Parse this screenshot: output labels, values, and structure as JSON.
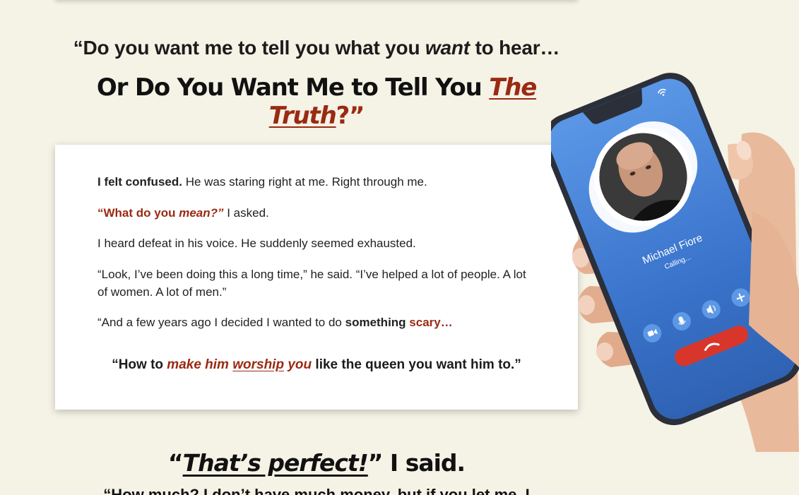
{
  "headline": {
    "line1_pre": "“Do you want me to tell you what you ",
    "line1_em": "want",
    "line1_post": " to hear…",
    "line2_pre": "Or Do You Want Me to Tell You ",
    "line2_truth": "The Truth",
    "line2_post": "?”"
  },
  "story": {
    "p1_bold": "I felt confused.",
    "p1_rest": " He was staring right at me. Right through me.",
    "p2_quote_a": "“What do you ",
    "p2_quote_b": "mean?”",
    "p2_rest": " I asked.",
    "p3": "I heard defeat in his voice. He suddenly seemed exhausted.",
    "p4": "“Look, I’ve been doing this a long time,” he said. “I’ve helped a lot of people. A lot of women. A lot of men.”",
    "p5_pre": "“And a few years ago I decided I wanted to do ",
    "p5_bold": "something",
    "p5_accent": " scary…",
    "quote_pre": "“How to ",
    "quote_a": "make him ",
    "quote_b": "worship",
    "quote_c": " you",
    "quote_post": " like the queen you want him to.”"
  },
  "perfect": {
    "pre": "“",
    "word": "That’s perfect!",
    "post": "” I said."
  },
  "bottom_cut": "“How much? I don’t have much money, but if you let me, I",
  "phone": {
    "caller_name": "Michael Fiore",
    "caller_status": "Calling...",
    "icons": [
      "video-icon",
      "mic-icon",
      "speaker-icon",
      "add-icon",
      "end-call-icon",
      "wifi-icon"
    ]
  },
  "colors": {
    "background": "#f5f2e6",
    "accent": "#9a2a12",
    "screen_blue": "#3f7fd6",
    "end_call_red": "#d9362b"
  }
}
